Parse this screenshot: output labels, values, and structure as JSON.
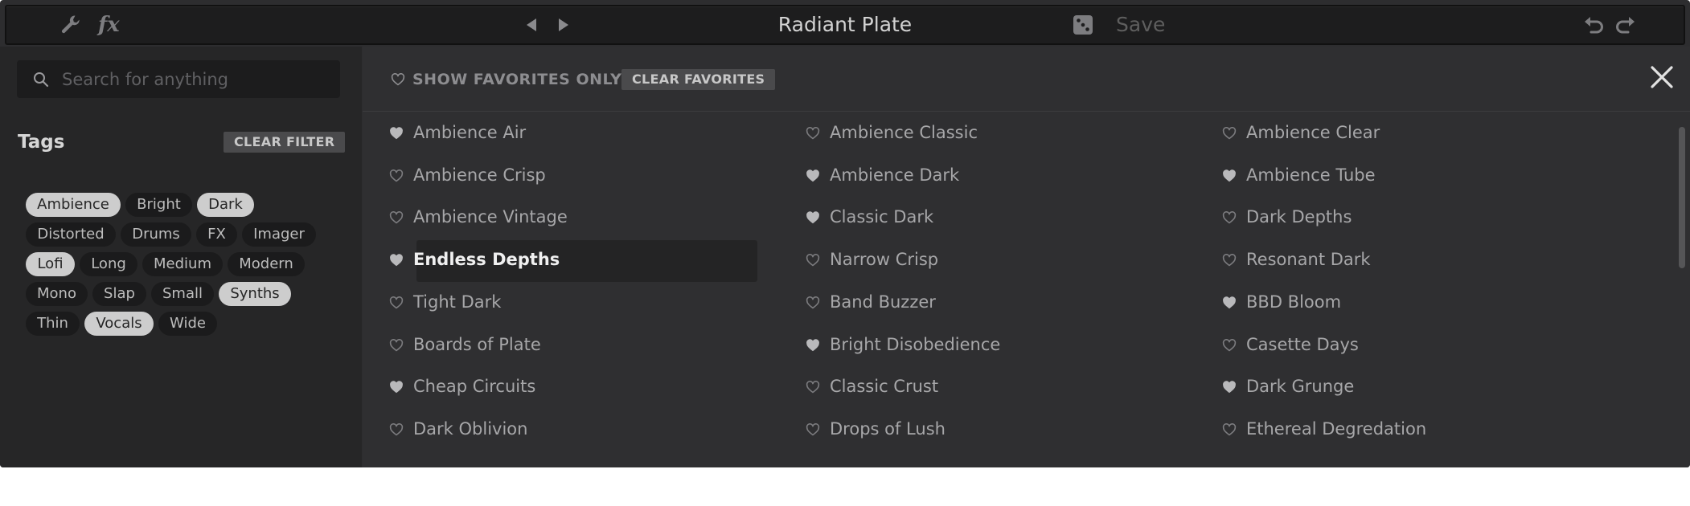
{
  "toolbar": {
    "title": "Radiant Plate",
    "save_label": "Save",
    "icons": [
      "wrench-icon",
      "fx-icon",
      "prev-preset-icon",
      "next-preset-icon",
      "dice-icon",
      "undo-icon",
      "redo-icon"
    ]
  },
  "sidebar": {
    "search_placeholder": "Search for anything",
    "tags_heading": "Tags",
    "clear_filter_label": "CLEAR FILTER",
    "tags": [
      {
        "label": "Ambience",
        "selected": true
      },
      {
        "label": "Bright",
        "selected": false
      },
      {
        "label": "Dark",
        "selected": true
      },
      {
        "label": "Distorted",
        "selected": false
      },
      {
        "label": "Drums",
        "selected": false
      },
      {
        "label": "FX",
        "selected": false
      },
      {
        "label": "Imager",
        "selected": false
      },
      {
        "label": "Lofi",
        "selected": true
      },
      {
        "label": "Long",
        "selected": false
      },
      {
        "label": "Medium",
        "selected": false
      },
      {
        "label": "Modern",
        "selected": false
      },
      {
        "label": "Mono",
        "selected": false
      },
      {
        "label": "Slap",
        "selected": false
      },
      {
        "label": "Small",
        "selected": false
      },
      {
        "label": "Synths",
        "selected": true
      },
      {
        "label": "Thin",
        "selected": false
      },
      {
        "label": "Vocals",
        "selected": true
      },
      {
        "label": "Wide",
        "selected": false
      }
    ]
  },
  "main": {
    "show_favorites_label": "SHOW FAVORITES ONLY",
    "clear_favorites_label": "CLEAR FAVORITES",
    "presets": [
      {
        "name": "Ambience Air",
        "favorite": true
      },
      {
        "name": "Ambience Classic",
        "favorite": false
      },
      {
        "name": "Ambience Clear",
        "favorite": false
      },
      {
        "name": "Ambience Crisp",
        "favorite": false
      },
      {
        "name": "Ambience Dark",
        "favorite": true
      },
      {
        "name": "Ambience Tube",
        "favorite": true
      },
      {
        "name": "Ambience Vintage",
        "favorite": false
      },
      {
        "name": "Classic Dark",
        "favorite": true
      },
      {
        "name": "Dark Depths",
        "favorite": false
      },
      {
        "name": "Endless Depths",
        "favorite": true,
        "selected": true
      },
      {
        "name": "Narrow Crisp",
        "favorite": false
      },
      {
        "name": "Resonant Dark",
        "favorite": false
      },
      {
        "name": "Tight Dark",
        "favorite": false
      },
      {
        "name": "Band Buzzer",
        "favorite": false
      },
      {
        "name": "BBD Bloom",
        "favorite": true
      },
      {
        "name": "Boards of Plate",
        "favorite": false
      },
      {
        "name": "Bright Disobedience",
        "favorite": true
      },
      {
        "name": "Casette Days",
        "favorite": false
      },
      {
        "name": "Cheap Circuits",
        "favorite": true
      },
      {
        "name": "Classic Crust",
        "favorite": false
      },
      {
        "name": "Dark Grunge",
        "favorite": true
      },
      {
        "name": "Dark Oblivion",
        "favorite": false
      },
      {
        "name": "Drops of Lush",
        "favorite": false
      },
      {
        "name": "Ethereal Degredation",
        "favorite": false
      }
    ]
  },
  "colors": {
    "panel": "#2f2f31",
    "sidebar": "#262627",
    "tag_selected": "#cdcdcd",
    "tag_unselected": "#1b1b1c",
    "heart": "#b9b9bb"
  }
}
